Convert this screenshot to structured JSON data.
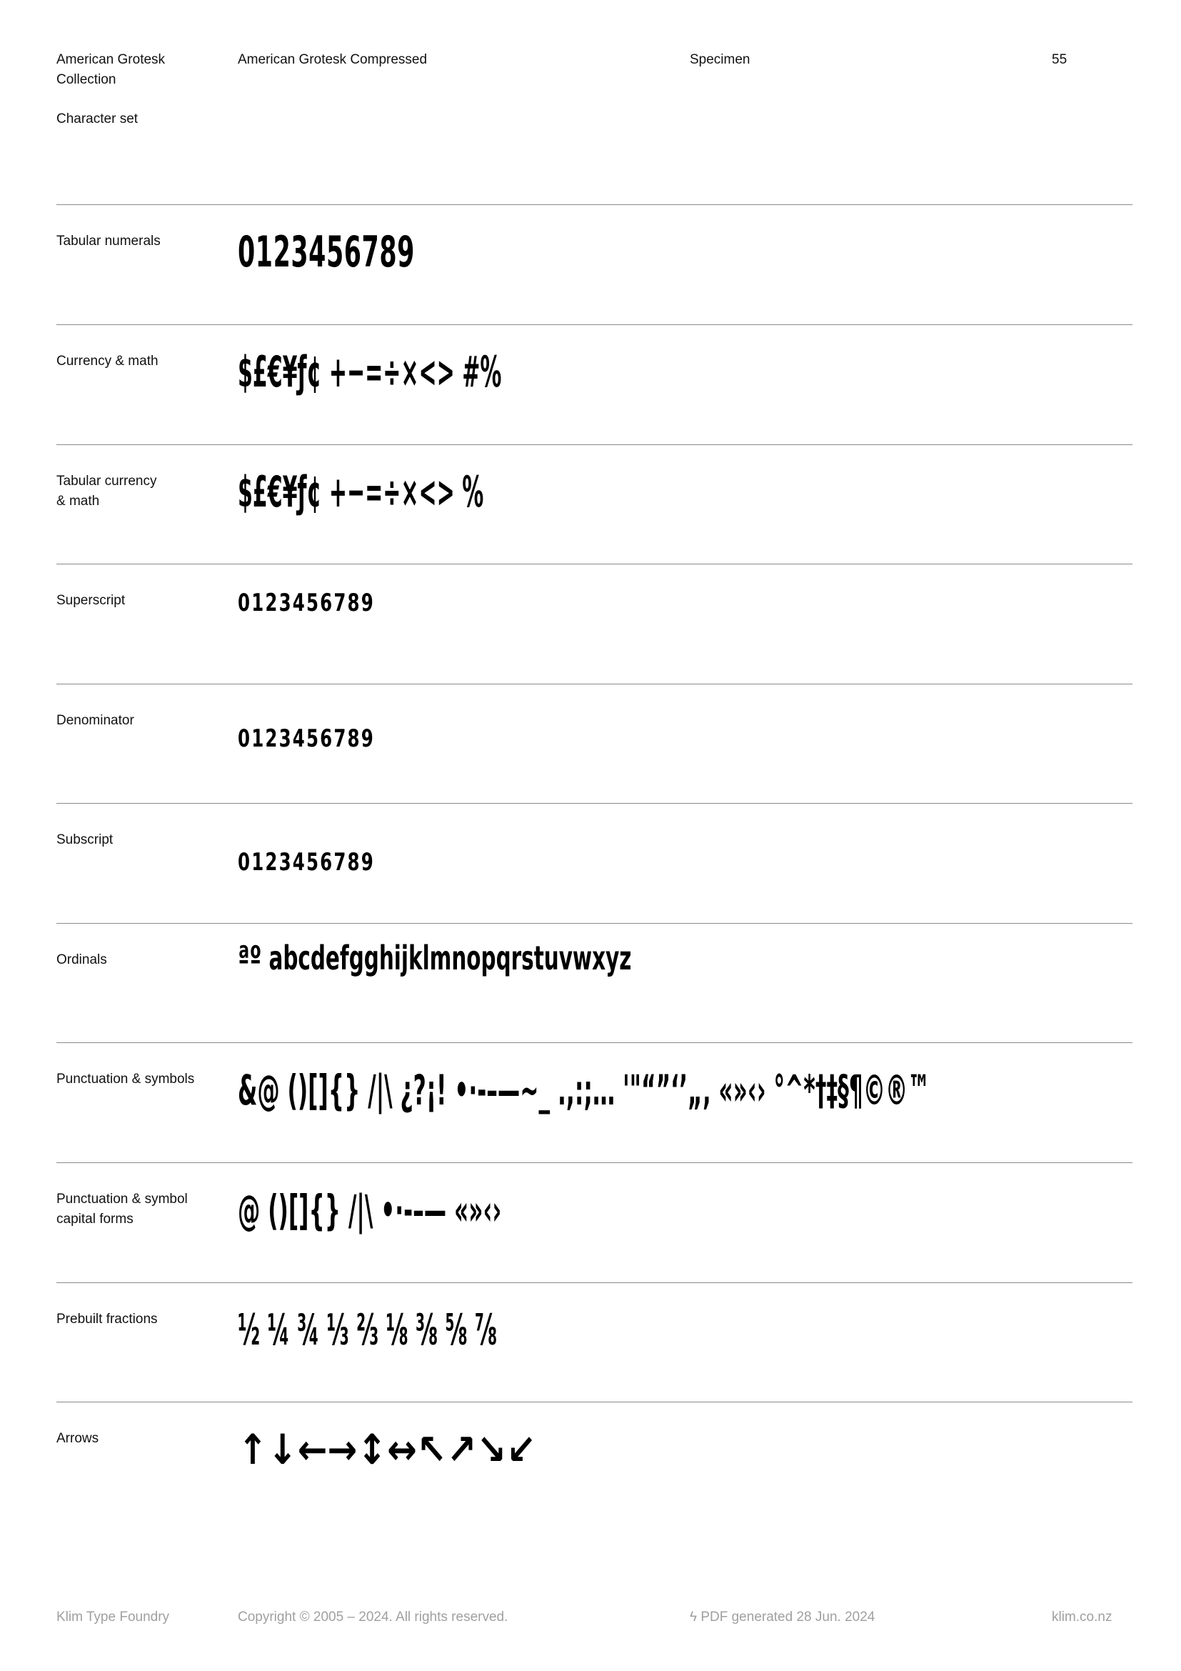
{
  "header": {
    "collection": "American Grotesk\nCollection",
    "section": "Character set",
    "family": "American Grotesk Compressed",
    "doc_type": "Specimen",
    "page_number": "55"
  },
  "rows": [
    {
      "label": "Tabular numerals",
      "sample": "0123456789"
    },
    {
      "label": "Currency & math",
      "sample": "$£€¥ƒ¢ +−=÷×<> #%"
    },
    {
      "label": "Tabular currency\n& math",
      "sample": "$£€¥ƒ¢ +−=÷×<> %"
    },
    {
      "label": "Superscript",
      "sample": "0123456789"
    },
    {
      "label": "Denominator",
      "sample": "0123456789"
    },
    {
      "label": "Subscript",
      "sample": "0123456789"
    },
    {
      "label": "Ordinals",
      "sample": "ªº abcdefgghijklmnopqrstuvwxyz"
    },
    {
      "label": "Punctuation & symbols",
      "sample": "&@ ()[]{} /|\\ ¿?¡! •·-–—~_ .,:;… '\"“”‘’„‚ «»‹› °^*†‡§¶©®™"
    },
    {
      "label": "Punctuation & symbol\ncapital forms",
      "sample": "@ ()[]{} /|\\ •·-–— «»‹›"
    },
    {
      "label": "Prebuilt fractions",
      "sample": "½ ¼ ¾ ⅓ ⅔ ⅛ ⅜ ⅝ ⅞"
    },
    {
      "label": "Arrows",
      "sample": "↑↓←→↕↔↖↗↘↙"
    }
  ],
  "footer": {
    "foundry": "Klim Type Foundry",
    "copyright": "Copyright © 2005 – 2024. All rights reserved.",
    "generated": "ϟ PDF generated 28 Jun. 2024",
    "website": "klim.co.nz"
  }
}
